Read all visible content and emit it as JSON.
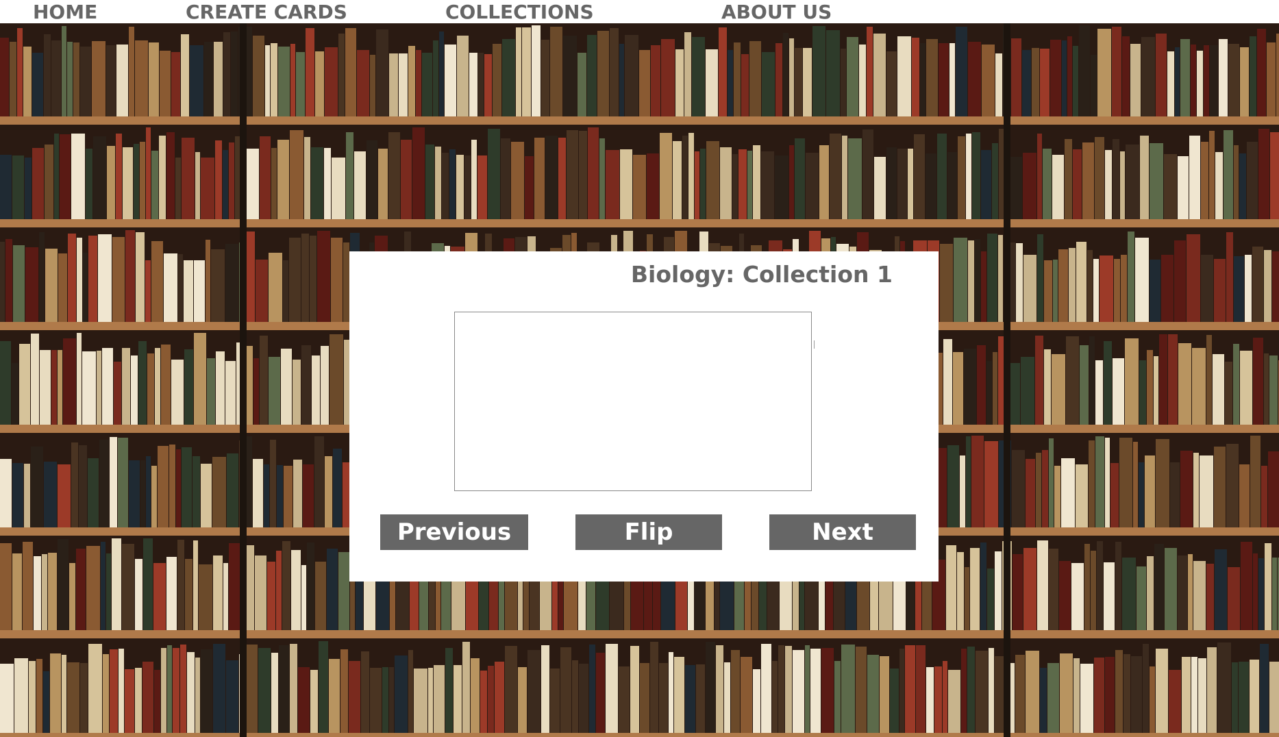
{
  "nav": {
    "home": "HOME",
    "create_cards": "CREATE CARDS",
    "collections": "COLLECTIONS",
    "about_us": "ABOUT US"
  },
  "background": {
    "description_icon": "bookshelf-photo",
    "shelf_color": "#b07a4a",
    "backing_color": "#2a1a12"
  },
  "panel": {
    "title": "Biology: Collection 1",
    "card_text": "",
    "buttons": {
      "previous": "Previous",
      "flip": "Flip",
      "next": "Next"
    },
    "button_color": "#666666"
  }
}
